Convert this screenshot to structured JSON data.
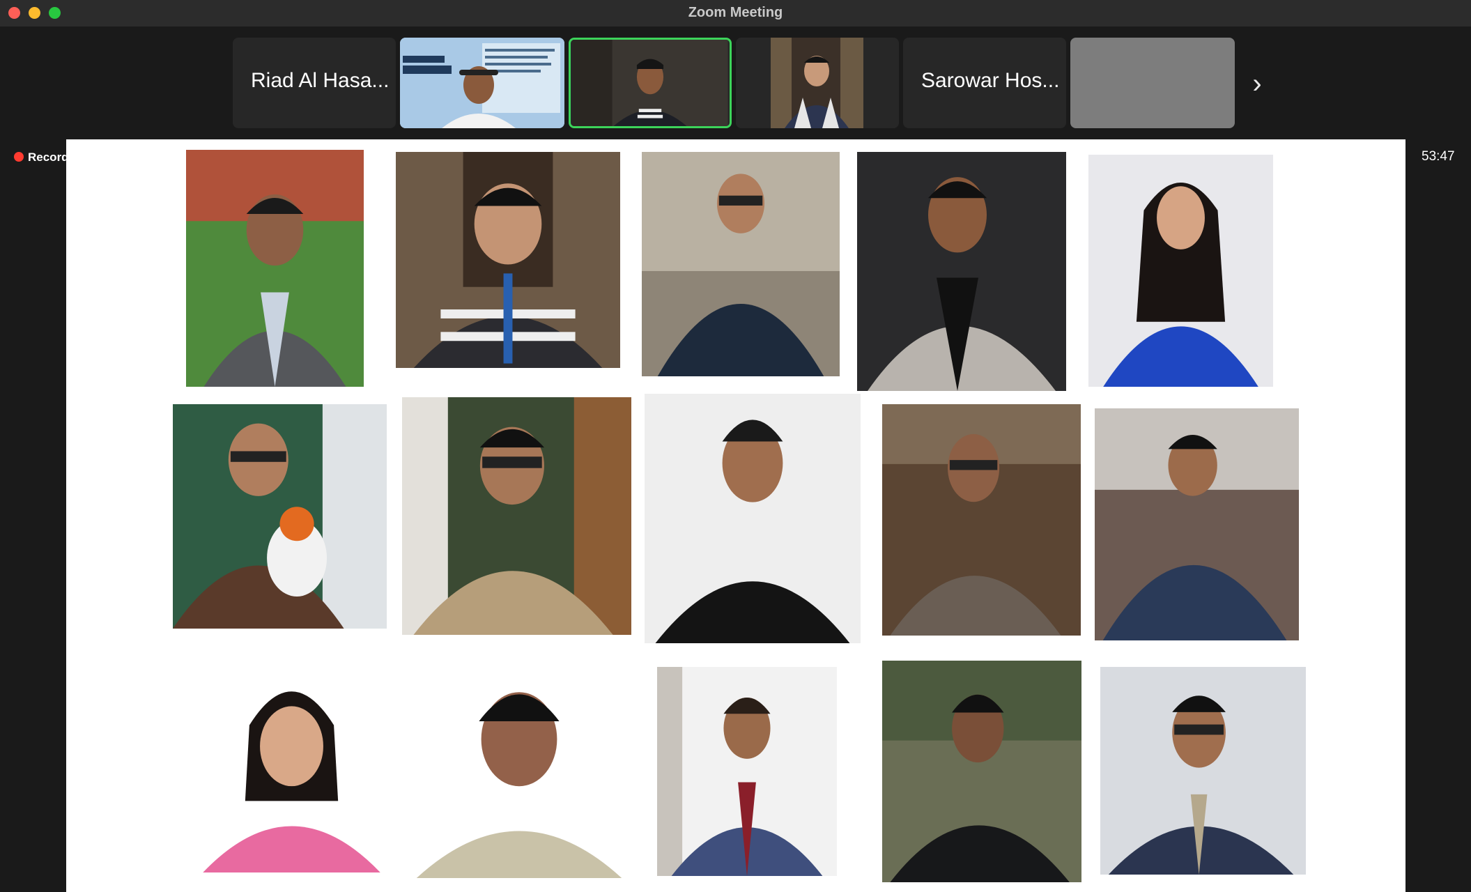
{
  "window": {
    "title": "Zoom Meeting"
  },
  "participants": [
    {
      "name": "Riad Al Hasa...",
      "type": "name"
    },
    {
      "type": "video"
    },
    {
      "type": "video",
      "active": true
    },
    {
      "type": "video"
    },
    {
      "name": "Sarowar Hos...",
      "type": "name"
    },
    {
      "type": "blank"
    }
  ],
  "strip": {
    "next_icon": "chevron-right-icon",
    "next_glyph": "›"
  },
  "recording": {
    "label": "Recording",
    "color": "#ff3b30"
  },
  "timer": "53:47",
  "colors": {
    "active_border": "#3cd45a",
    "tile_bg": "#272727"
  }
}
